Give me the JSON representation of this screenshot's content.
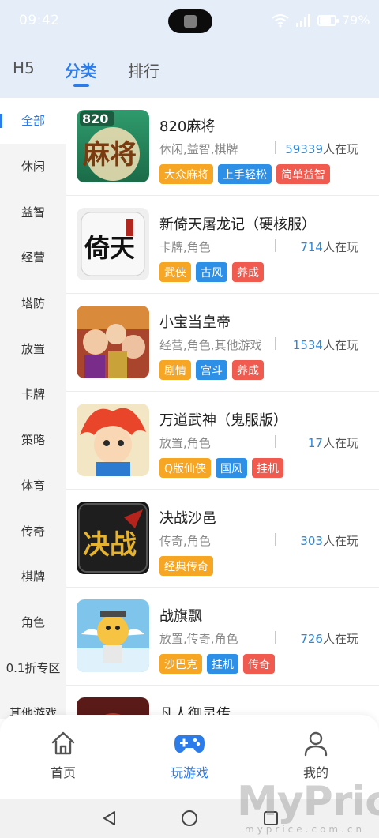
{
  "status": {
    "time": "09:42",
    "battery": "79%",
    "battery_level": 0.79
  },
  "tabs": [
    {
      "label": "H5"
    },
    {
      "label": "分类",
      "active": true
    },
    {
      "label": "排行"
    }
  ],
  "sidebar": {
    "items": [
      {
        "label": "全部",
        "active": true
      },
      {
        "label": "休闲"
      },
      {
        "label": "益智"
      },
      {
        "label": "经营"
      },
      {
        "label": "塔防"
      },
      {
        "label": "放置"
      },
      {
        "label": "卡牌"
      },
      {
        "label": "策略"
      },
      {
        "label": "体育"
      },
      {
        "label": "传奇"
      },
      {
        "label": "棋牌"
      },
      {
        "label": "角色"
      },
      {
        "label": "0.1折专区"
      },
      {
        "label": "其他游戏"
      }
    ]
  },
  "games": [
    {
      "name": "820麻将",
      "categories": "休闲,益智,棋牌",
      "players": "59339",
      "players_suffix": "人在玩",
      "tags": [
        {
          "text": "大众麻将",
          "color": "orange"
        },
        {
          "text": "上手轻松",
          "color": "blue"
        },
        {
          "text": "简单益智",
          "color": "red"
        }
      ],
      "thumb_text": "820",
      "thumb_logo": "麻将"
    },
    {
      "name": "新倚天屠龙记（硬核服）",
      "categories": "卡牌,角色",
      "players": "714",
      "players_suffix": "人在玩",
      "tags": [
        {
          "text": "武侠",
          "color": "orange"
        },
        {
          "text": "古风",
          "color": "blue"
        },
        {
          "text": "养成",
          "color": "red"
        }
      ],
      "thumb_logo": "倚天"
    },
    {
      "name": "小宝当皇帝",
      "categories": "经营,角色,其他游戏",
      "players": "1534",
      "players_suffix": "人在玩",
      "tags": [
        {
          "text": "剧情",
          "color": "orange"
        },
        {
          "text": "宫斗",
          "color": "blue"
        },
        {
          "text": "养成",
          "color": "red"
        }
      ]
    },
    {
      "name": "万道武神（鬼服版）",
      "categories": "放置,角色",
      "players": "17",
      "players_suffix": "人在玩",
      "tags": [
        {
          "text": "Q版仙侠",
          "color": "orange"
        },
        {
          "text": "国风",
          "color": "blue"
        },
        {
          "text": "挂机",
          "color": "red"
        }
      ]
    },
    {
      "name": "决战沙邑",
      "categories": "传奇,角色",
      "players": "303",
      "players_suffix": "人在玩",
      "tags": [
        {
          "text": "经典传奇",
          "color": "orange"
        }
      ],
      "thumb_logo": "决战"
    },
    {
      "name": "战旗飘",
      "categories": "放置,传奇,角色",
      "players": "726",
      "players_suffix": "人在玩",
      "tags": [
        {
          "text": "沙巴克",
          "color": "orange"
        },
        {
          "text": "挂机",
          "color": "blue"
        },
        {
          "text": "传奇",
          "color": "red"
        }
      ]
    },
    {
      "name": "凡人御灵传",
      "categories": "",
      "players": "",
      "players_suffix": "",
      "tags": []
    }
  ],
  "bottom_nav": [
    {
      "label": "首页",
      "icon": "home-icon"
    },
    {
      "label": "玩游戏",
      "icon": "gamepad-icon",
      "active": true
    },
    {
      "label": "我的",
      "icon": "user-icon"
    }
  ],
  "system_nav": [
    "back-icon",
    "home-circle-icon",
    "recents-icon"
  ],
  "watermark": {
    "text": "MyPrice",
    "sub": "myprice.com.cn"
  }
}
